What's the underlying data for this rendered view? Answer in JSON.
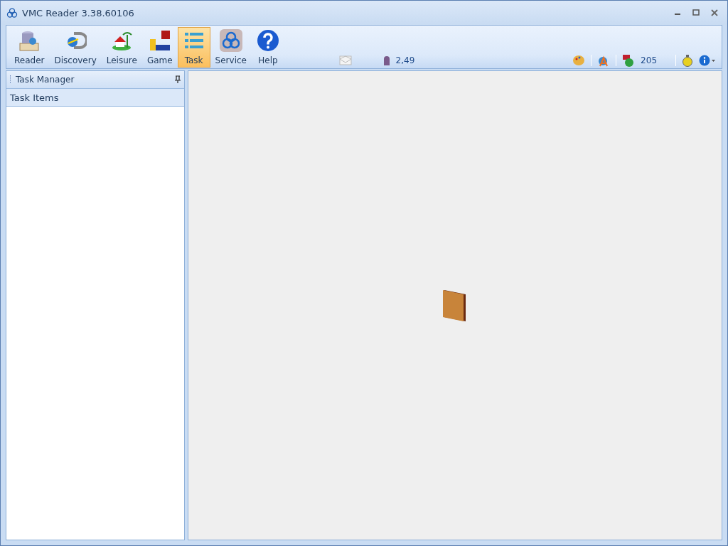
{
  "window": {
    "title": "VMC Reader  3.38.60106"
  },
  "toolbar": {
    "buttons": [
      {
        "label": "Reader",
        "kind": "reader",
        "selected": false
      },
      {
        "label": "Discovery",
        "kind": "discovery",
        "selected": false
      },
      {
        "label": "Leisure",
        "kind": "leisure",
        "selected": false
      },
      {
        "label": "Game",
        "kind": "game",
        "selected": false
      },
      {
        "label": "Task",
        "kind": "task",
        "selected": true
      },
      {
        "label": "Service",
        "kind": "service",
        "selected": false
      },
      {
        "label": "Help",
        "kind": "help",
        "selected": false
      }
    ]
  },
  "status": {
    "credits": "2,49",
    "count": "205"
  },
  "task_panel": {
    "title": "Task Manager",
    "header": "Task Items"
  }
}
